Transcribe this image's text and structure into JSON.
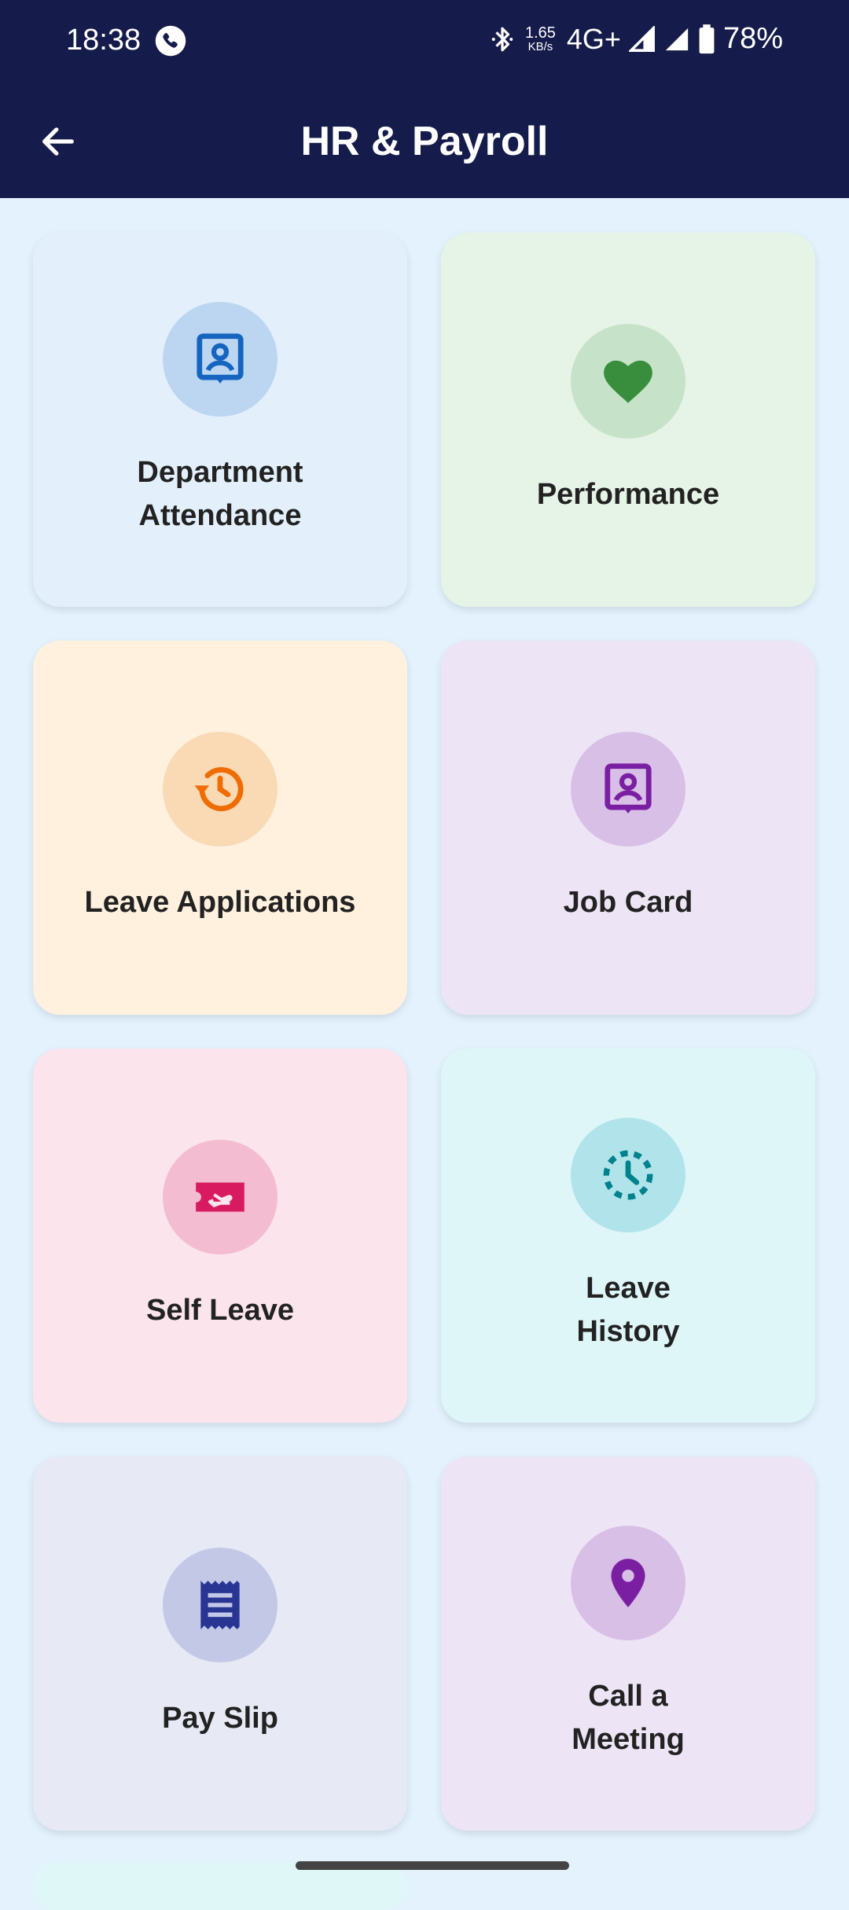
{
  "status_bar": {
    "time": "18:38",
    "speed_value": "1.65",
    "speed_unit": "KB/s",
    "network": "4G+",
    "battery": "78%"
  },
  "app_bar": {
    "title": "HR & Payroll",
    "back_icon": "arrow-left-icon"
  },
  "colors": {
    "app_bar_bg": "#151b4a",
    "page_bg": "#e3f2fd"
  },
  "cards": [
    {
      "label": "Department\nAttendance",
      "icon": "contact-page-icon",
      "bg": "#e3f0fb",
      "circle": "#bcd6f2",
      "icon_color": "#1565c0"
    },
    {
      "label": "Performance",
      "icon": "heart-icon",
      "bg": "#e6f4e7",
      "circle": "#c6e2c8",
      "icon_color": "#388e3c"
    },
    {
      "label": "Leave Applications",
      "icon": "history-icon",
      "bg": "#fff1de",
      "circle": "#fad9b5",
      "icon_color": "#ef6c00"
    },
    {
      "label": "Job Card",
      "icon": "contact-page-icon",
      "bg": "#ede5f5",
      "circle": "#d8bfe6",
      "icon_color": "#7b1fa2"
    },
    {
      "label": "Self Leave",
      "icon": "airplane-ticket-icon",
      "bg": "#fbe4ec",
      "circle": "#f4bcd0",
      "icon_color": "#d81b60"
    },
    {
      "label": "Leave\nHistory",
      "icon": "timelapse-clock-icon",
      "bg": "#def6f8",
      "circle": "#b1e4ea",
      "icon_color": "#00838f"
    },
    {
      "label": "Pay Slip",
      "icon": "receipt-icon",
      "bg": "#e7e9f5",
      "circle": "#c3c8e6",
      "icon_color": "#283593"
    },
    {
      "label": "Call a\nMeeting",
      "icon": "location-pin-icon",
      "bg": "#ede5f5",
      "circle": "#d8bfe6",
      "icon_color": "#7b1fa2"
    }
  ]
}
